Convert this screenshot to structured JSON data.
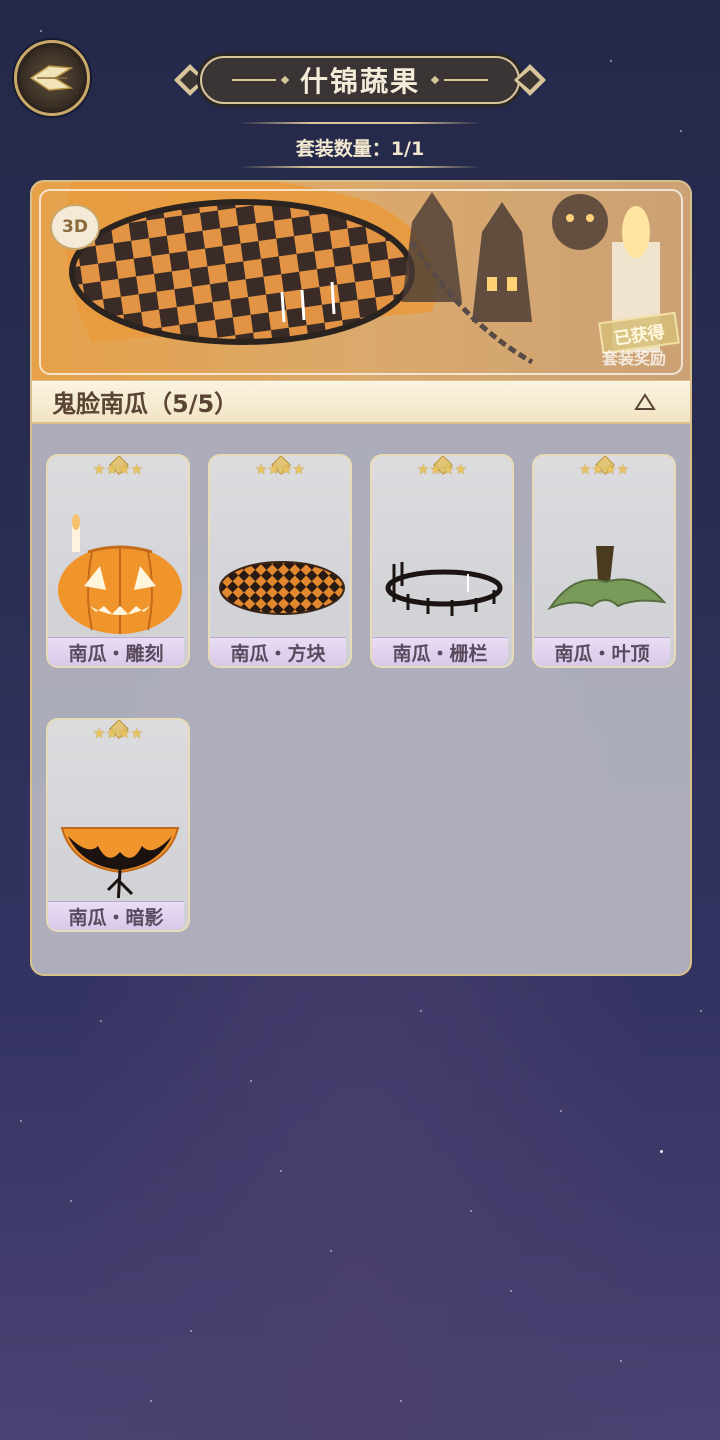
{
  "header": {
    "title": "什锦蔬果",
    "set_count": "套装数量：1/1"
  },
  "banner": {
    "badge_3d": "3D",
    "obtained_label": "已获得",
    "reward_label": "套装奖励"
  },
  "set": {
    "name": "鬼脸南瓜（5/5）"
  },
  "items": [
    {
      "name": "南瓜・雕刻",
      "stars": "★★★★"
    },
    {
      "name": "南瓜・方块",
      "stars": "★★★★"
    },
    {
      "name": "南瓜・栅栏",
      "stars": "★★★★"
    },
    {
      "name": "南瓜・叶顶",
      "stars": "★★★★"
    },
    {
      "name": "南瓜・暗影",
      "stars": "★★★★"
    }
  ],
  "icons": {
    "back": "back-arrow-icon",
    "collapse": "triangle-up-icon",
    "rating": "star-icon"
  },
  "colors": {
    "accent_gold": "#d9c08a",
    "card_name_bg": "#d9c8ea",
    "star": "#e8c463"
  }
}
